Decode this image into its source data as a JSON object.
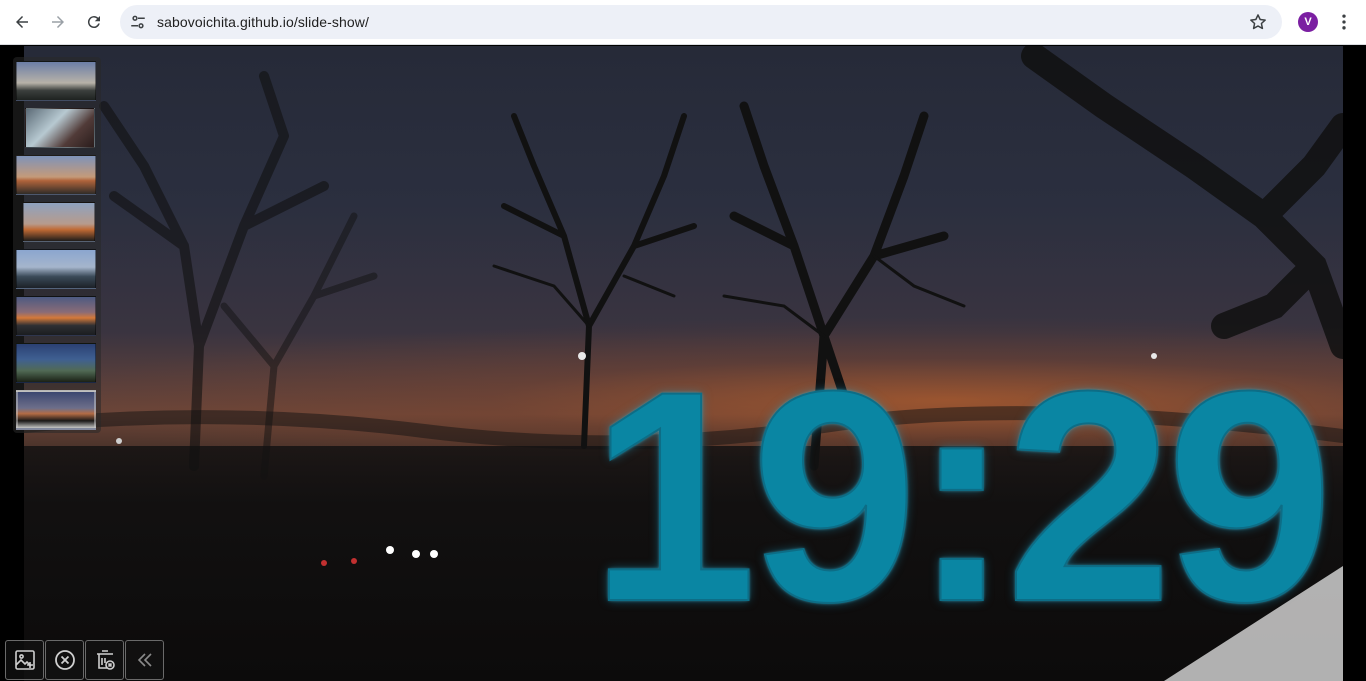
{
  "browser": {
    "url": "sabovoichita.github.io/slide-show/",
    "profile_initial": "V",
    "colors": {
      "omnibox_bg": "#edf0f7",
      "avatar": "#7b1fa2"
    }
  },
  "thumbnails": [
    {
      "id": "thumb-1",
      "active": false
    },
    {
      "id": "thumb-2",
      "active": false
    },
    {
      "id": "thumb-3",
      "active": false
    },
    {
      "id": "thumb-4",
      "active": false
    },
    {
      "id": "thumb-5",
      "active": false
    },
    {
      "id": "thumb-6",
      "active": false
    },
    {
      "id": "thumb-7",
      "active": false
    },
    {
      "id": "thumb-8",
      "active": true
    }
  ],
  "clock": {
    "time": "19:29",
    "color": "#0a86a3"
  },
  "toolbar": {
    "buttons": [
      {
        "name": "add-image-button",
        "icon": "image-add-icon"
      },
      {
        "name": "close-button",
        "icon": "close-circle-icon"
      },
      {
        "name": "delete-all-button",
        "icon": "trash-clear-icon"
      },
      {
        "name": "collapse-button",
        "icon": "double-chevron-left-icon"
      }
    ]
  }
}
